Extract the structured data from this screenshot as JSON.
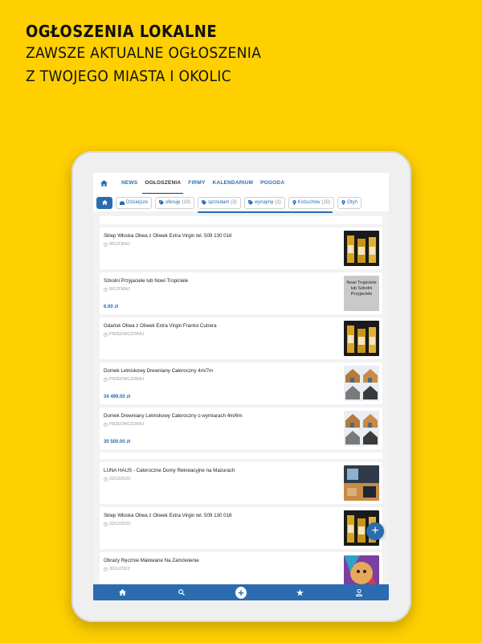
{
  "promo": {
    "line1": "OGŁOSZENIA LOKALNE",
    "line2": "ZAWSZE AKTUALNE OGŁOSZENIA",
    "line3": "Z TWOJEGO MIASTA I OKOLIC"
  },
  "nav": {
    "tabs": [
      {
        "label": "NEWS"
      },
      {
        "label": "OGŁOSZENIA"
      },
      {
        "label": "FIRMY"
      },
      {
        "label": "KALENDARIUM"
      },
      {
        "label": "POGODA"
      }
    ]
  },
  "filters": [
    {
      "label": "Dzisiejsze",
      "count": "",
      "icon": "briefcase-icon"
    },
    {
      "label": "oferuję",
      "count": "(10)",
      "icon": "tag-icon"
    },
    {
      "label": "sprzedam",
      "count": "(3)",
      "icon": "tag-icon"
    },
    {
      "label": "wynajmę",
      "count": "(1)",
      "icon": "tag-icon"
    },
    {
      "label": "Kożuchów",
      "count": "(10)",
      "icon": "pin-icon"
    },
    {
      "label": "Otyń",
      "count": "",
      "icon": "pin-icon"
    }
  ],
  "listings": [
    {
      "title": "Sklep Włoska Oliwa z Oliwek Extra Virgin tel. 509 130 018",
      "date": "WCZORAJ",
      "price": ""
    },
    {
      "title": "Szkolni Przyjaciele lub Nowi Tropiciele",
      "date": "WCZORAJ",
      "price": "6.00 zł",
      "thumb_text": "Nowi Tropiciele lub Szkolni Przyjaciele"
    },
    {
      "title": "Gdańsk Oliwa z Oliwek Extra Virgin Frantoi Cutrera",
      "date": "PRZEDWCZORAJ",
      "price": ""
    },
    {
      "title": "Domek Letniskowy Drewniany Całoroczny 4m/7m",
      "date": "PRZEDWCZORAJ",
      "price": "34 499.00 zł"
    },
    {
      "title": "Domek Drewniany Letniskowy Całoroczny o wymiarach 4m/6m",
      "date": "PRZEDWCZORAJ",
      "price": "30 500.00 zł"
    },
    {
      "title": "LUNA HAUS - Całoroczne Domy Rekreacyjne na Mazurach",
      "date": "03/12/2023",
      "price": ""
    },
    {
      "title": "Sklep Włoska Oliwa z Oliwek Extra Virgin tel. 509 130 018",
      "date": "03/12/2023",
      "price": ""
    },
    {
      "title": "Obrazy Ręcznie Malowane Na Zamówienie",
      "date": "30/11/2023",
      "price": ""
    }
  ],
  "colors": {
    "brand_yellow": "#FFD000",
    "accent_blue": "#2b6cb0"
  }
}
